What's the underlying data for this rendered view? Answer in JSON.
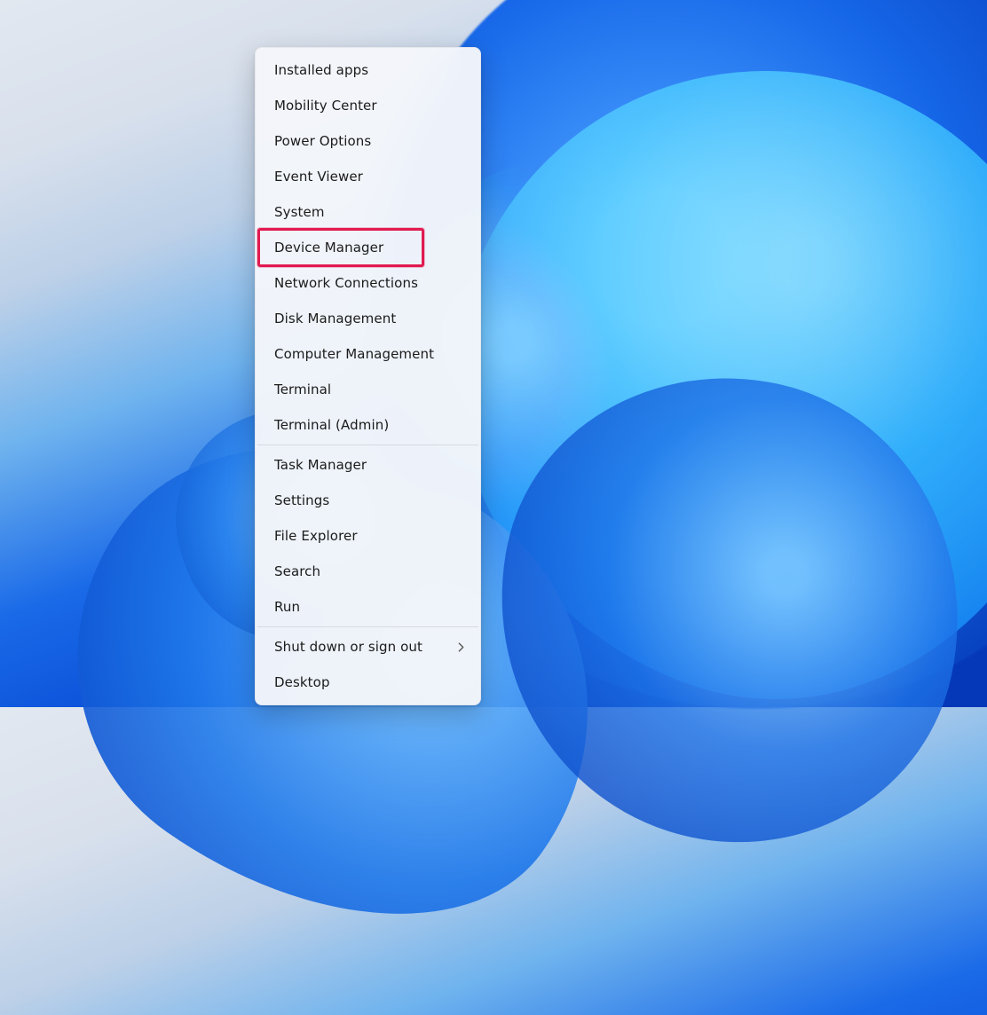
{
  "menu": {
    "items": [
      {
        "label": "Installed apps",
        "has_submenu": false,
        "highlighted": false
      },
      {
        "label": "Mobility Center",
        "has_submenu": false,
        "highlighted": false
      },
      {
        "label": "Power Options",
        "has_submenu": false,
        "highlighted": false
      },
      {
        "label": "Event Viewer",
        "has_submenu": false,
        "highlighted": false
      },
      {
        "label": "System",
        "has_submenu": false,
        "highlighted": false
      },
      {
        "label": "Device Manager",
        "has_submenu": false,
        "highlighted": true
      },
      {
        "label": "Network Connections",
        "has_submenu": false,
        "highlighted": false
      },
      {
        "label": "Disk Management",
        "has_submenu": false,
        "highlighted": false
      },
      {
        "label": "Computer Management",
        "has_submenu": false,
        "highlighted": false
      },
      {
        "label": "Terminal",
        "has_submenu": false,
        "highlighted": false
      },
      {
        "label": "Terminal (Admin)",
        "has_submenu": false,
        "highlighted": false
      },
      {
        "separator": true
      },
      {
        "label": "Task Manager",
        "has_submenu": false,
        "highlighted": false
      },
      {
        "label": "Settings",
        "has_submenu": false,
        "highlighted": false
      },
      {
        "label": "File Explorer",
        "has_submenu": false,
        "highlighted": false
      },
      {
        "label": "Search",
        "has_submenu": false,
        "highlighted": false
      },
      {
        "label": "Run",
        "has_submenu": false,
        "highlighted": false
      },
      {
        "separator": true
      },
      {
        "label": "Shut down or sign out",
        "has_submenu": true,
        "highlighted": false
      },
      {
        "label": "Desktop",
        "has_submenu": false,
        "highlighted": false
      }
    ]
  },
  "colors": {
    "highlight_border": "#e11a4f",
    "menu_bg": "rgba(244,246,250,0.97)",
    "text": "#1b1b1b"
  }
}
